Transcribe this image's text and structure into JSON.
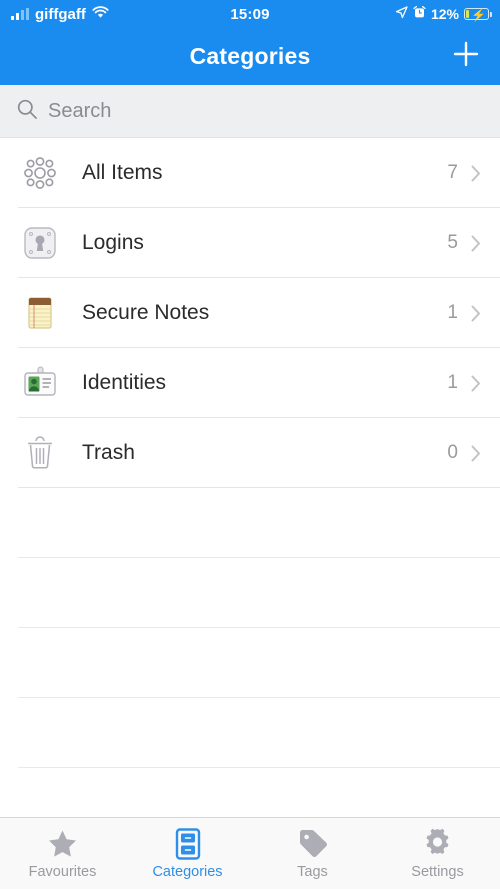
{
  "status_bar": {
    "carrier": "giffgaff",
    "time": "15:09",
    "battery_percent": "12%",
    "signal_icon": "signal-bars-icon",
    "wifi_icon": "wifi-icon",
    "location_icon": "location-arrow-icon",
    "alarm_icon": "alarm-clock-icon",
    "battery_icon": "battery-charging-icon"
  },
  "navbar": {
    "title": "Categories",
    "add_icon": "plus-icon",
    "background_color": "#1a8cf0"
  },
  "search": {
    "placeholder": "Search",
    "icon": "search-icon"
  },
  "list": {
    "rows": [
      {
        "label": "All Items",
        "count": "7",
        "icon": "all-items-icon"
      },
      {
        "label": "Logins",
        "count": "5",
        "icon": "login-keyhole-icon"
      },
      {
        "label": "Secure Notes",
        "count": "1",
        "icon": "secure-note-icon"
      },
      {
        "label": "Identities",
        "count": "1",
        "icon": "identity-card-icon"
      },
      {
        "label": "Trash",
        "count": "0",
        "icon": "trash-icon"
      }
    ],
    "empty_row_count": 5,
    "chevron_icon": "chevron-right-icon"
  },
  "tabbar": {
    "active_color": "#2f8fe8",
    "inactive_color": "#9a9aa0",
    "tabs": [
      {
        "label": "Favourites",
        "icon": "star-icon",
        "active": false
      },
      {
        "label": "Categories",
        "icon": "filing-cabinet-icon",
        "active": true
      },
      {
        "label": "Tags",
        "icon": "tag-icon",
        "active": false
      },
      {
        "label": "Settings",
        "icon": "gear-icon",
        "active": false
      }
    ]
  }
}
